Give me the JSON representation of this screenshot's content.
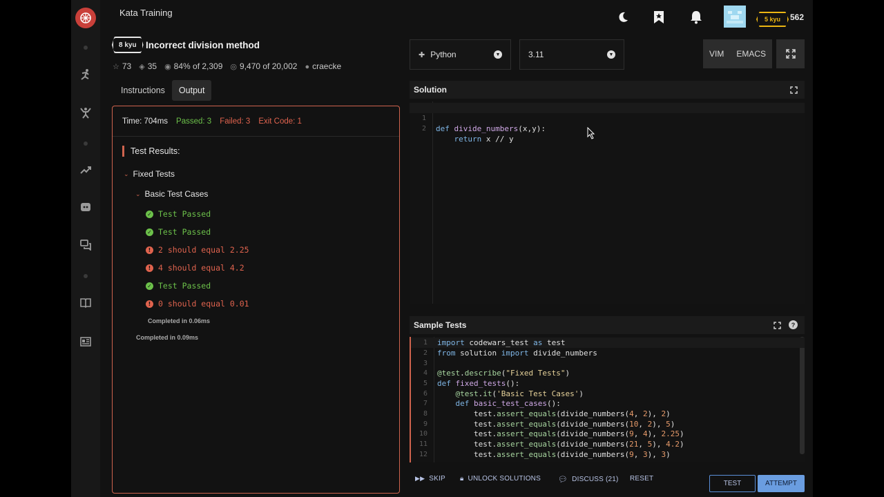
{
  "header": {
    "section_title": "Kata Training",
    "rank_badge": "5 kyu",
    "honor": "562"
  },
  "kata": {
    "rank": "8 kyu",
    "title": "Incorrect division method",
    "stars": "73",
    "collections": "35",
    "satisfaction": "84% of 2,309",
    "completions": "9,470 of 20,002",
    "author": "craecke"
  },
  "tabs": {
    "instructions": "Instructions",
    "output": "Output"
  },
  "output": {
    "time": "Time: 704ms",
    "passed": "Passed: 3",
    "failed": "Failed: 3",
    "exit_code": "Exit Code: 1",
    "heading": "Test Results:",
    "group_label": "Fixed Tests",
    "subgroup_label": "Basic Test Cases",
    "results": [
      {
        "status": "pass",
        "text": "Test Passed"
      },
      {
        "status": "pass",
        "text": "Test Passed"
      },
      {
        "status": "fail",
        "text": "2 should equal 2.25"
      },
      {
        "status": "fail",
        "text": "4 should equal 4.2"
      },
      {
        "status": "pass",
        "text": "Test Passed"
      },
      {
        "status": "fail",
        "text": "0 should equal 0.01"
      }
    ],
    "inner_completed": "Completed in 0.06ms",
    "outer_completed": "Completed in 0.09ms"
  },
  "editor_settings": {
    "language": "Python",
    "version": "3.11",
    "vim_label": "VIM",
    "emacs_label": "EMACS"
  },
  "solution": {
    "title": "Solution",
    "lines": [
      "def divide_numbers(x,y):",
      "    return x // y"
    ]
  },
  "sample_tests": {
    "title": "Sample Tests",
    "lines": [
      "import codewars_test as test",
      "from solution import divide_numbers",
      "",
      "@test.describe(\"Fixed Tests\")",
      "def fixed_tests():",
      "    @test.it('Basic Test Cases')",
      "    def basic_test_cases():",
      "        test.assert_equals(divide_numbers(4, 2), 2)",
      "        test.assert_equals(divide_numbers(10, 2), 5)",
      "        test.assert_equals(divide_numbers(9, 4), 2.25)",
      "        test.assert_equals(divide_numbers(21, 5), 4.2)",
      "        test.assert_equals(divide_numbers(9, 3), 3)"
    ]
  },
  "actions": {
    "skip": "SKIP",
    "unlock": "UNLOCK SOLUTIONS",
    "discuss": "DISCUSS (21)",
    "reset": "RESET",
    "test": "TEST",
    "attempt": "ATTEMPT"
  }
}
